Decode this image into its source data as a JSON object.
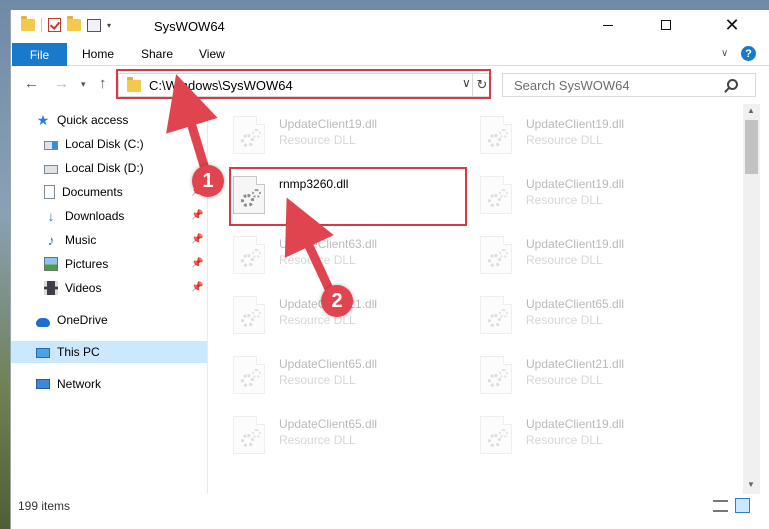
{
  "window": {
    "title": "SysWOW64"
  },
  "ribbon": {
    "tabs": [
      {
        "label": "File",
        "active": true
      },
      {
        "label": "Home"
      },
      {
        "label": "Share"
      },
      {
        "label": "View"
      }
    ],
    "help_label": "?"
  },
  "address_bar": {
    "path": "C:\\Windows\\SysWOW64"
  },
  "search": {
    "placeholder": "Search SysWOW64"
  },
  "sidebar": {
    "items": [
      {
        "label": "Quick access",
        "icon": "star-icon"
      },
      {
        "label": "Local Disk (C:)",
        "icon": "disk-icon",
        "pinned": false
      },
      {
        "label": "Local Disk (D:)",
        "icon": "disk-icon",
        "pinned": false
      },
      {
        "label": "Documents",
        "icon": "documents-icon",
        "pinned": true
      },
      {
        "label": "Downloads",
        "icon": "downloads-icon",
        "pinned": true
      },
      {
        "label": "Music",
        "icon": "music-icon",
        "pinned": true
      },
      {
        "label": "Pictures",
        "icon": "pictures-icon",
        "pinned": true
      },
      {
        "label": "Videos",
        "icon": "videos-icon",
        "pinned": true
      },
      {
        "label": "OneDrive",
        "icon": "cloud-icon"
      },
      {
        "label": "This PC",
        "icon": "pc-icon",
        "selected": true
      },
      {
        "label": "Network",
        "icon": "network-icon"
      }
    ]
  },
  "files": [
    {
      "name": "UpdateClient19.dll",
      "type": "Resource DLL",
      "faded": true
    },
    {
      "name": "UpdateClient19.dll",
      "type": "Resource DLL",
      "faded": true
    },
    {
      "name": "rnmp3260.dll",
      "type": "",
      "faded": false
    },
    {
      "name": "UpdateClient19.dll",
      "type": "Resource DLL",
      "faded": true
    },
    {
      "name": "UpdateClient63.dll",
      "type": "Resource DLL",
      "faded": true
    },
    {
      "name": "UpdateClient19.dll",
      "type": "Resource DLL",
      "faded": true
    },
    {
      "name": "UpdateClient21.dll",
      "type": "Resource DLL",
      "faded": true
    },
    {
      "name": "UpdateClient65.dll",
      "type": "Resource DLL",
      "faded": true
    },
    {
      "name": "UpdateClient65.dll",
      "type": "Resource DLL",
      "faded": true
    },
    {
      "name": "UpdateClient21.dll",
      "type": "Resource DLL",
      "faded": true
    },
    {
      "name": "UpdateClient65.dll",
      "type": "Resource DLL",
      "faded": true
    },
    {
      "name": "UpdateClient19.dll",
      "type": "Resource DLL",
      "faded": true
    }
  ],
  "status": {
    "item_count": "199 items"
  },
  "annotations": {
    "step1": "1",
    "step2": "2",
    "color": "#e0454f"
  },
  "colors": {
    "accent": "#1979ca",
    "selected_bg": "#cce8ff"
  }
}
